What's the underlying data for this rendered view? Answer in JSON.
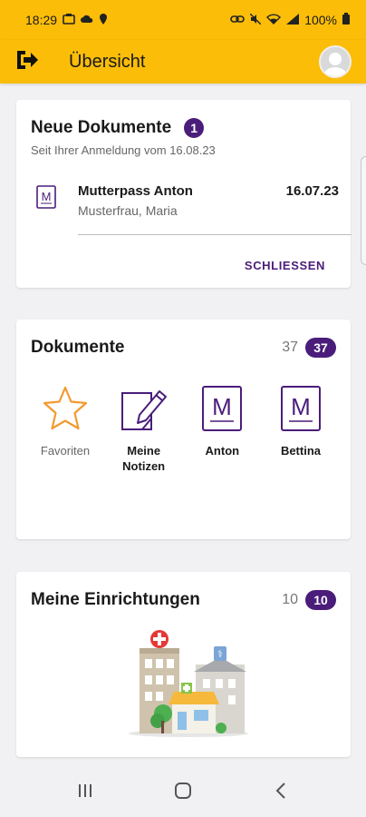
{
  "status_bar": {
    "time": "18:29",
    "battery": "100%"
  },
  "app_bar": {
    "title": "Übersicht"
  },
  "new_documents": {
    "title": "Neue Dokumente",
    "badge": "1",
    "subtitle": "Seit Ihrer Anmeldung vom 16.08.23",
    "item": {
      "name": "Mutterpass Anton",
      "author": "Musterfrau, Maria",
      "date": "16.07.23"
    },
    "close_label": "SCHLIESSEN"
  },
  "documents": {
    "title": "Dokumente",
    "count": "37",
    "badge": "37",
    "tiles": [
      {
        "label": "Favoriten",
        "icon": "star-icon"
      },
      {
        "label": "Meine Notizen",
        "icon": "note-edit-icon"
      },
      {
        "label": "Anton",
        "icon": "mutterpass-icon"
      },
      {
        "label": "Bettina",
        "icon": "mutterpass-icon"
      }
    ]
  },
  "facilities": {
    "title": "Meine Einrichtungen",
    "count": "10",
    "badge": "10"
  },
  "colors": {
    "header": "#fbbd08",
    "accent": "#4a1d7a",
    "star": "#f29a2e"
  }
}
